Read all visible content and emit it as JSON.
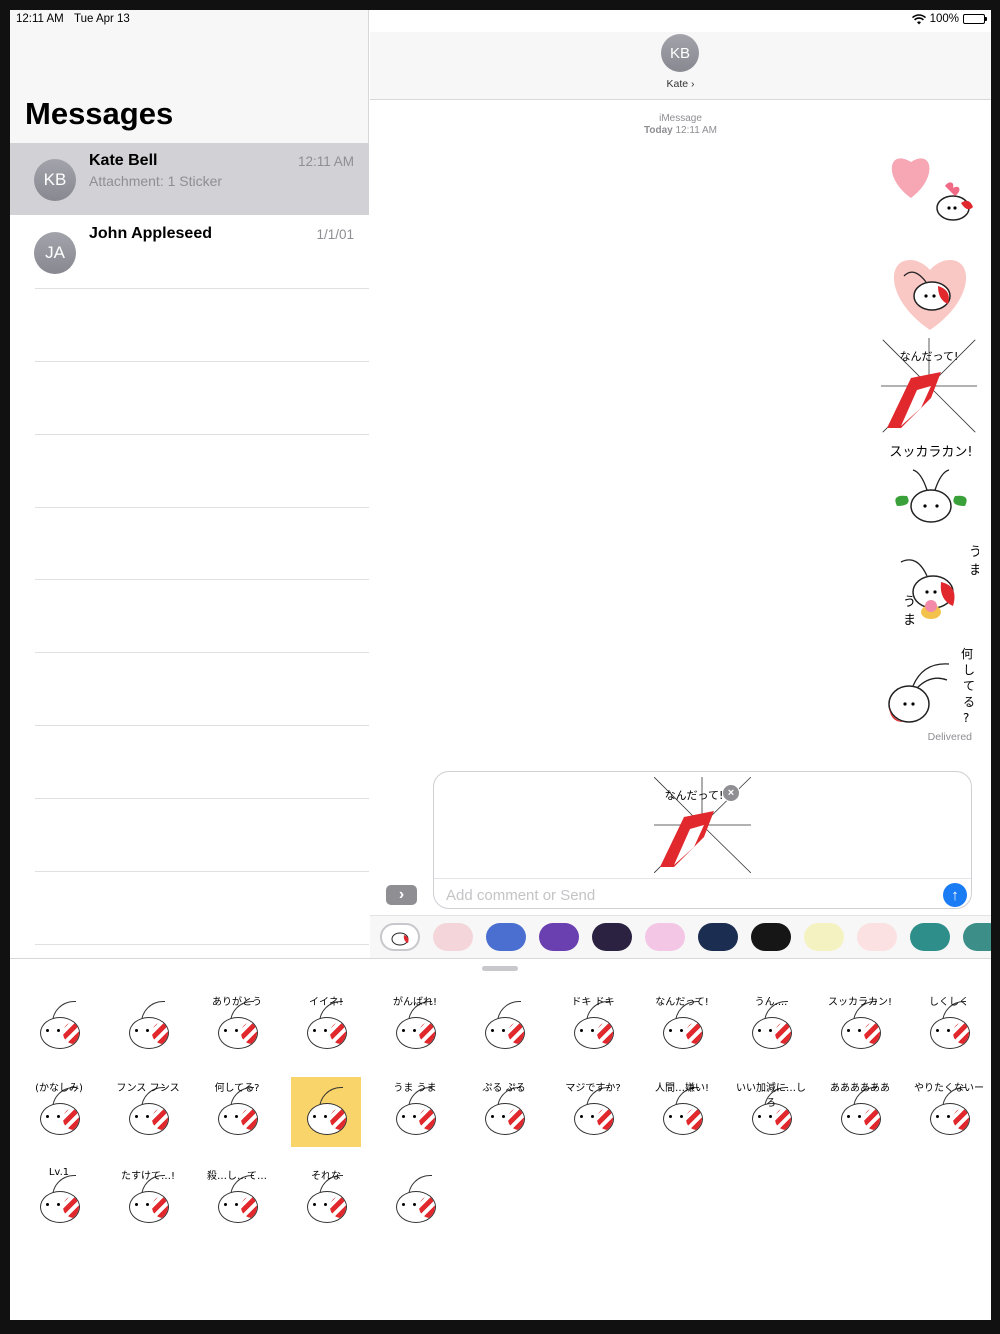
{
  "status_bar": {
    "time": "12:11 AM",
    "date": "Tue Apr 13",
    "battery": "100%"
  },
  "sidebar": {
    "title": "Messages",
    "conversations": [
      {
        "initials": "KB",
        "name": "Kate Bell",
        "preview": "Attachment: 1 Sticker",
        "time": "12:11 AM",
        "selected": true
      },
      {
        "initials": "JA",
        "name": "John Appleseed",
        "preview": "",
        "time": "1/1/01",
        "selected": false
      }
    ]
  },
  "conversation": {
    "contact_initials": "KB",
    "contact_name": "Kate ›",
    "service_label": "iMessage",
    "timestamp_day": "Today",
    "timestamp_time": "12:11 AM",
    "delivered": "Delivered",
    "sent_stickers": [
      {
        "icon": "heart-shrimp-sticker"
      },
      {
        "icon": "shrimp-in-heart-sticker"
      },
      {
        "icon": "shocked-shrimp-sticker",
        "text": "なんだって!"
      },
      {
        "icon": "broke-shrimp-sticker",
        "text": "スッカラカン!"
      },
      {
        "icon": "yummy-shrimp-sticker",
        "text": "うま うま"
      },
      {
        "icon": "what-doing-shrimp-sticker",
        "text": "何してる?"
      }
    ]
  },
  "compose": {
    "attachment_icon": "shocked-shrimp-sticker",
    "attachment_text": "なんだって!",
    "placeholder": "Add comment or Send",
    "value": ""
  },
  "app_strip": {
    "apps": [
      {
        "icon": "shrimp-stickers-app",
        "color": "#ffffff"
      },
      {
        "icon": "crab-app",
        "color": "#f4d6da"
      },
      {
        "icon": "blue-fish-app",
        "color": "#4a6fd0"
      },
      {
        "icon": "purple-fish-app",
        "color": "#6a3fb0"
      },
      {
        "icon": "dark-fish-app",
        "color": "#2a2240"
      },
      {
        "icon": "pink-octopus-app",
        "color": "#f3c6e6"
      },
      {
        "icon": "jellyfish-app",
        "color": "#1b2d50"
      },
      {
        "icon": "orange-fish-app",
        "color": "#161616"
      },
      {
        "icon": "frog-app",
        "color": "#f5f2c2"
      },
      {
        "icon": "shrimp-red-app",
        "color": "#fbe1e1"
      },
      {
        "icon": "pufferfish-app",
        "color": "#2e8f8a"
      },
      {
        "icon": "crab-orange-app",
        "color": "#3b8f88"
      }
    ]
  },
  "sticker_drawer": {
    "stickers": [
      {
        "label": "",
        "icon": "heart-shrimp-sticker"
      },
      {
        "label": "",
        "icon": "shrimp-in-heart-sticker"
      },
      {
        "label": "ありがとう",
        "icon": "thanks-shrimp-sticker"
      },
      {
        "label": "イイネ!",
        "icon": "like-shrimp-sticker"
      },
      {
        "label": "がんばれ!",
        "icon": "cheer-shrimp-sticker"
      },
      {
        "label": "",
        "icon": "love-shrimp-sticker"
      },
      {
        "label": "ドキ ドキ",
        "icon": "nervous-shrimp-sticker"
      },
      {
        "label": "なんだって!",
        "icon": "shocked-shrimp-sticker"
      },
      {
        "label": "うん....",
        "icon": "nod-shrimp-sticker"
      },
      {
        "label": "スッカラカン!",
        "icon": "broke-shrimp-sticker"
      },
      {
        "label": "しくしく",
        "icon": "crying-shrimp-sticker"
      },
      {
        "label": "(かなしみ)",
        "icon": "sad-shrimp-sticker"
      },
      {
        "label": "フンス フンス",
        "icon": "huff-shrimp-sticker"
      },
      {
        "label": "何してる?",
        "icon": "what-doing-shrimp-sticker"
      },
      {
        "label": "",
        "icon": "yellow-shrimp-sticker"
      },
      {
        "label": "うま うま",
        "icon": "yummy-shrimp-sticker"
      },
      {
        "label": "ぷる ぷる",
        "icon": "shiver-shrimp-sticker"
      },
      {
        "label": "マジですか?",
        "icon": "really-shrimp-sticker"
      },
      {
        "label": "人間…嫌い!",
        "icon": "hate-humans-shrimp-sticker"
      },
      {
        "label": "いい加減に…しろ",
        "icon": "enough-shrimp-sticker"
      },
      {
        "label": "ああああああ",
        "icon": "scream-shrimp-sticker"
      },
      {
        "label": "やりたくないー",
        "icon": "lazy-shrimp-sticker"
      },
      {
        "label": "Lv.1",
        "icon": "lowhp-shrimp-sticker"
      },
      {
        "label": "たすけて…!",
        "icon": "help-shrimp-sticker"
      },
      {
        "label": "殺…し…て…",
        "icon": "dying-shrimp-sticker"
      },
      {
        "label": "それな",
        "icon": "exactly-shrimp-sticker"
      },
      {
        "label": "",
        "icon": "walking-shrimp-sticker"
      }
    ]
  }
}
